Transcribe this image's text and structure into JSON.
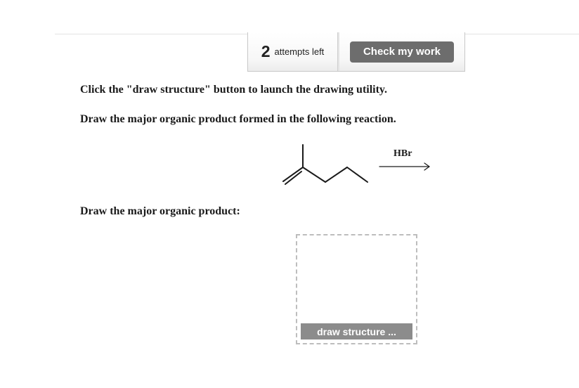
{
  "toolbar": {
    "attempts_count": "2",
    "attempts_label": "attempts left",
    "check_label": "Check my work"
  },
  "question": {
    "instruction_1": "Click the \"draw structure\" button to launch the drawing utility.",
    "instruction_2": "Draw the major organic product formed in the following reaction.",
    "reagent": "HBr",
    "product_prompt": "Draw the major organic product:"
  },
  "answer_box": {
    "button_label": "draw structure ..."
  }
}
